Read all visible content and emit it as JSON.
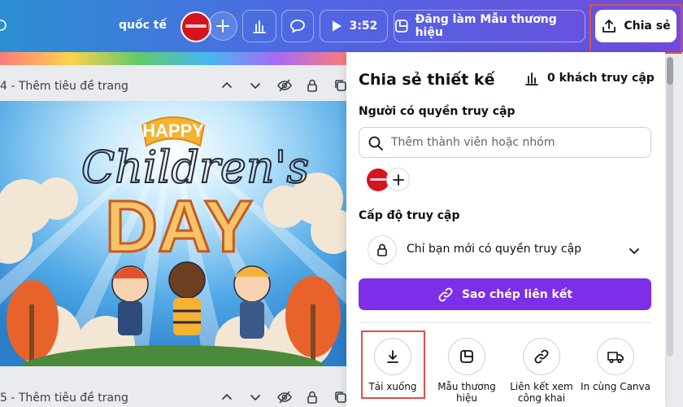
{
  "topbar": {
    "brand_text": "quốc tế",
    "timer_label": "3:52",
    "brand_template_label": "Đăng làm Mẫu thương hiệu",
    "share_label": "Chia sẻ"
  },
  "pages": [
    {
      "title": "4 - Thêm tiêu đề trang"
    },
    {
      "title": "5 - Thêm tiêu đề trang"
    }
  ],
  "artwork": {
    "banner_text": "HAPPY",
    "script_text": "Children's",
    "day_text": "DAY"
  },
  "share_panel": {
    "title": "Chia sẻ thiết kế",
    "visitors": "0 khách truy cập",
    "people_access_label": "Người có quyền truy cập",
    "search_placeholder": "Thêm thành viên hoặc nhóm",
    "access_level_label": "Cấp độ truy cập",
    "access_level_value": "Chỉ bạn mới có quyền truy cập",
    "copy_link_label": "Sao chép liên kết",
    "actions": [
      {
        "label": "Tải xuống",
        "icon": "download-icon"
      },
      {
        "label": "Mẫu thương hiệu",
        "icon": "template-icon"
      },
      {
        "label": "Liên kết xem công khai",
        "icon": "link-icon"
      },
      {
        "label": "In cùng Canva",
        "icon": "truck-icon"
      }
    ]
  },
  "colors": {
    "accent": "#7c2ee8",
    "highlight": "#d9534a",
    "avatar": "#d4141f"
  }
}
